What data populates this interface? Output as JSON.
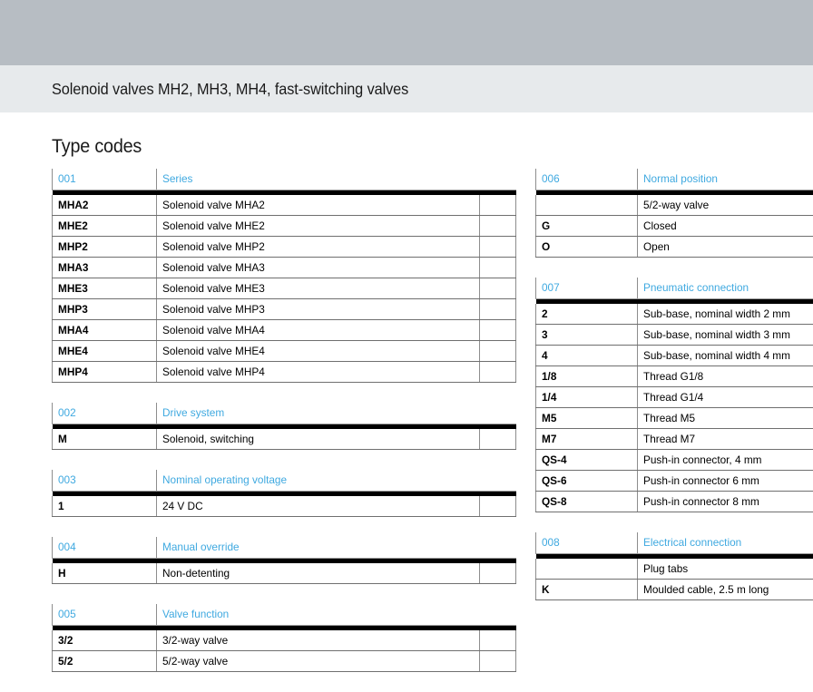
{
  "header": {
    "title": "Solenoid valves MH2, MH3, MH4, fast-switching valves"
  },
  "section": {
    "heading": "Type codes"
  },
  "colors": {
    "accent_blue": "#3fa9e0",
    "band_top": "#b7bdc3",
    "band_title": "#e7eaec",
    "rule_black": "#000000"
  },
  "left_column": [
    {
      "id": "001",
      "title": "Series",
      "rows": [
        {
          "code": "MHA2",
          "desc": "Solenoid valve MHA2"
        },
        {
          "code": "MHE2",
          "desc": "Solenoid valve MHE2"
        },
        {
          "code": "MHP2",
          "desc": "Solenoid valve MHP2"
        },
        {
          "code": "MHA3",
          "desc": "Solenoid valve MHA3"
        },
        {
          "code": "MHE3",
          "desc": "Solenoid valve MHE3"
        },
        {
          "code": "MHP3",
          "desc": "Solenoid valve MHP3"
        },
        {
          "code": "MHA4",
          "desc": "Solenoid valve MHA4"
        },
        {
          "code": "MHE4",
          "desc": "Solenoid valve MHE4"
        },
        {
          "code": "MHP4",
          "desc": "Solenoid valve MHP4"
        }
      ]
    },
    {
      "id": "002",
      "title": "Drive system",
      "rows": [
        {
          "code": "M",
          "desc": "Solenoid, switching"
        }
      ]
    },
    {
      "id": "003",
      "title": "Nominal operating voltage",
      "rows": [
        {
          "code": "1",
          "desc": "24 V DC"
        }
      ]
    },
    {
      "id": "004",
      "title": "Manual override",
      "rows": [
        {
          "code": "H",
          "desc": "Non-detenting"
        }
      ]
    },
    {
      "id": "005",
      "title": "Valve function",
      "rows": [
        {
          "code": "3/2",
          "desc": "3/2-way valve"
        },
        {
          "code": "5/2",
          "desc": "5/2-way valve"
        }
      ]
    }
  ],
  "right_column": [
    {
      "id": "006",
      "title": "Normal position",
      "rows": [
        {
          "code": "",
          "desc": "5/2-way valve"
        },
        {
          "code": "G",
          "desc": "Closed"
        },
        {
          "code": "O",
          "desc": "Open"
        }
      ]
    },
    {
      "id": "007",
      "title": "Pneumatic connection",
      "rows": [
        {
          "code": "2",
          "desc": "Sub-base, nominal width 2 mm"
        },
        {
          "code": "3",
          "desc": "Sub-base, nominal width 3 mm"
        },
        {
          "code": "4",
          "desc": "Sub-base, nominal width 4 mm"
        },
        {
          "code": "1/8",
          "desc": "Thread G1/8"
        },
        {
          "code": "1/4",
          "desc": "Thread G1/4"
        },
        {
          "code": "M5",
          "desc": "Thread M5"
        },
        {
          "code": "M7",
          "desc": "Thread M7"
        },
        {
          "code": "QS-4",
          "desc": "Push-in connector, 4 mm"
        },
        {
          "code": "QS-6",
          "desc": "Push-in connector 6 mm"
        },
        {
          "code": "QS-8",
          "desc": "Push-in connector 8 mm"
        }
      ]
    },
    {
      "id": "008",
      "title": "Electrical connection",
      "rows": [
        {
          "code": "",
          "desc": "Plug tabs"
        },
        {
          "code": "K",
          "desc": "Moulded cable, 2.5 m long"
        }
      ]
    }
  ]
}
